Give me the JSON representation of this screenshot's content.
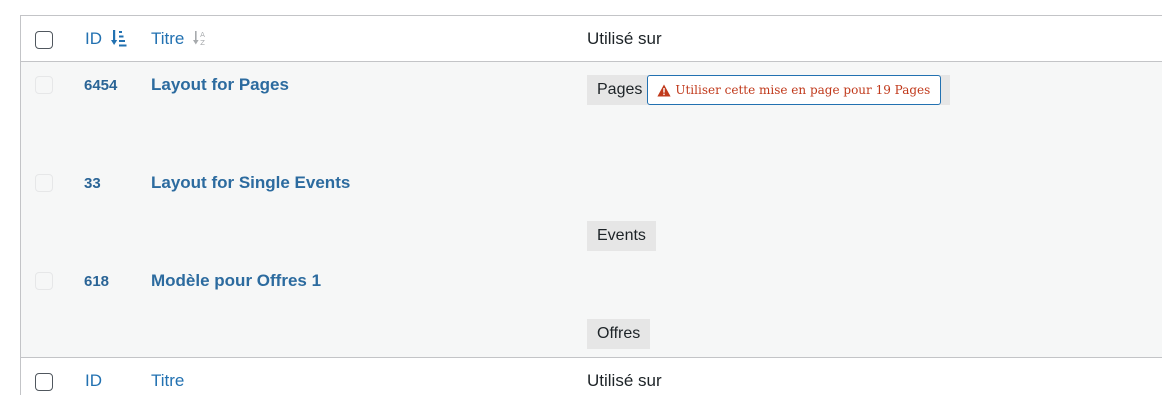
{
  "columns": {
    "id_label": "ID",
    "title_label": "Titre",
    "used_label": "Utilisé sur"
  },
  "rows": [
    {
      "id": "6454",
      "title": "Layout for Pages",
      "used_on": "Pages",
      "warning": "Utiliser cette mise en page pour 19 Pages"
    },
    {
      "id": "33",
      "title": "Layout for Single Events",
      "used_on": "Events"
    },
    {
      "id": "618",
      "title": "Modèle pour Offres 1",
      "used_on": "Offres"
    }
  ],
  "footer": {
    "id_label": "ID",
    "title_label": "Titre",
    "used_label": "Utilisé sur"
  },
  "icons": {
    "id_sort": "sort-numeric-desc-icon",
    "title_sort": "sort-alpha-asc-icon",
    "warning": "warning-triangle-icon"
  },
  "colors": {
    "link": "#2271b1",
    "warning_text": "#c0391b",
    "row_background": "#f6f7f7",
    "tag_background": "#e6e6e6"
  }
}
